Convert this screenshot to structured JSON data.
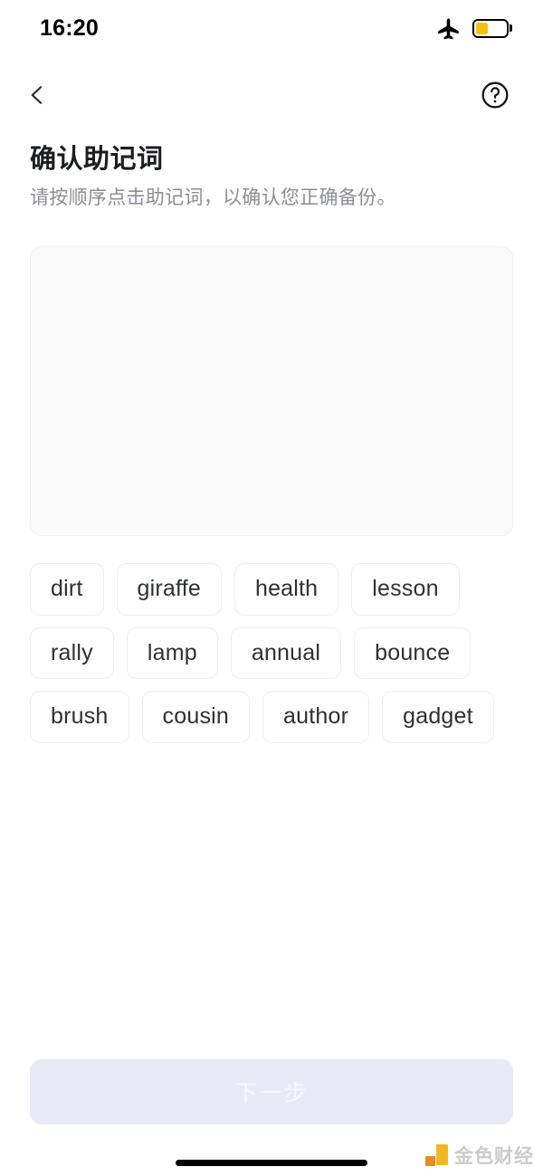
{
  "status_bar": {
    "time": "16:20",
    "airplane_icon": "airplane-mode-icon",
    "battery_icon": "battery-icon",
    "battery_level_percent": 40,
    "battery_fill_color": "#f5c211"
  },
  "nav": {
    "back_icon": "chevron-left-icon",
    "help_icon": "help-circle-icon"
  },
  "heading": {
    "title": "确认助记词",
    "subtitle": "请按顺序点击助记词，以确认您正确备份。"
  },
  "dropzone": {
    "name": "selected-mnemonic-area",
    "selected_words": []
  },
  "word_bank": {
    "words": [
      "dirt",
      "giraffe",
      "health",
      "lesson",
      "rally",
      "lamp",
      "annual",
      "bounce",
      "brush",
      "cousin",
      "author",
      "gadget"
    ]
  },
  "footer": {
    "next_label": "下一步",
    "next_disabled": true,
    "next_bg_color": "#e9e9f6"
  },
  "watermark": {
    "text": "金色财经"
  }
}
